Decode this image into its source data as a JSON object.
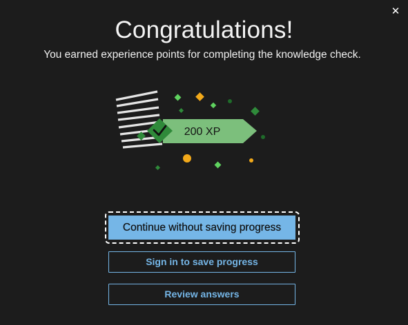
{
  "dialog": {
    "close_glyph": "✕",
    "title": "Congratulations!",
    "subtitle": "You earned experience points for completing the knowledge check.",
    "badge": {
      "xp_label": "200 XP",
      "icon": "checkmark-icon"
    },
    "buttons": {
      "continue_label": "Continue without saving progress",
      "signin_label": "Sign in to save progress",
      "review_label": "Review answers"
    },
    "colors": {
      "background": "#1c1c1c",
      "accent_blue": "#75b6e7",
      "badge_green": "#7cbf7c",
      "badge_dark_green": "#2f8a3a",
      "confetti_gold": "#f2a91a",
      "confetti_green": "#5fd35f"
    }
  }
}
